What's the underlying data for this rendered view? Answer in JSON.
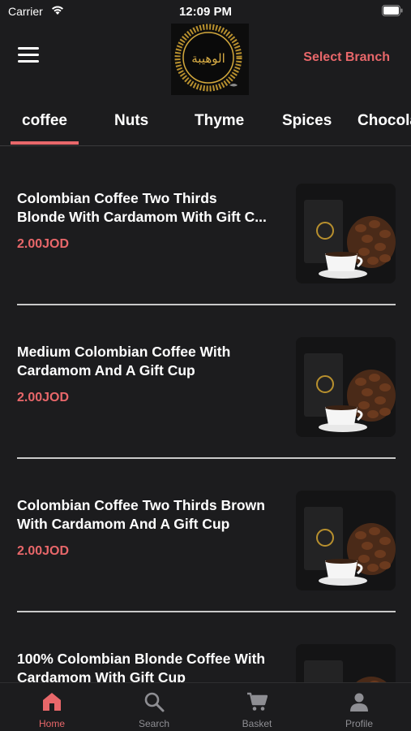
{
  "status_bar": {
    "carrier": "Carrier",
    "time": "12:09 PM"
  },
  "header": {
    "select_branch": "Select Branch",
    "logo_text": "الوهيبة"
  },
  "tabs": [
    {
      "label": "coffee",
      "active": true
    },
    {
      "label": "Nuts"
    },
    {
      "label": "Thyme"
    },
    {
      "label": "Spices"
    },
    {
      "label": "Chocola"
    }
  ],
  "products": [
    {
      "title_line1": "Colombian Coffee Two Thirds",
      "title_line2": "Blonde With Cardamom With Gift C...",
      "price": "2.00JOD"
    },
    {
      "title_line1": "Medium Colombian Coffee With",
      "title_line2": "Cardamom And A Gift Cup",
      "price": "2.00JOD"
    },
    {
      "title_line1": "Colombian Coffee Two Thirds Brown",
      "title_line2": "With Cardamom And A Gift Cup",
      "price": "2.00JOD"
    },
    {
      "title_line1": "100% Colombian Blonde Coffee With",
      "title_line2": "Cardamom With Gift Cup",
      "price": ""
    }
  ],
  "bottom_nav": [
    {
      "label": "Home",
      "icon": "home-icon",
      "active": true
    },
    {
      "label": "Search",
      "icon": "search-icon"
    },
    {
      "label": "Basket",
      "icon": "cart-icon"
    },
    {
      "label": "Profile",
      "icon": "profile-icon"
    }
  ],
  "colors": {
    "accent": "#e8676a",
    "background": "#1c1c1e",
    "text": "#ffffff",
    "muted": "#8e8e93"
  }
}
